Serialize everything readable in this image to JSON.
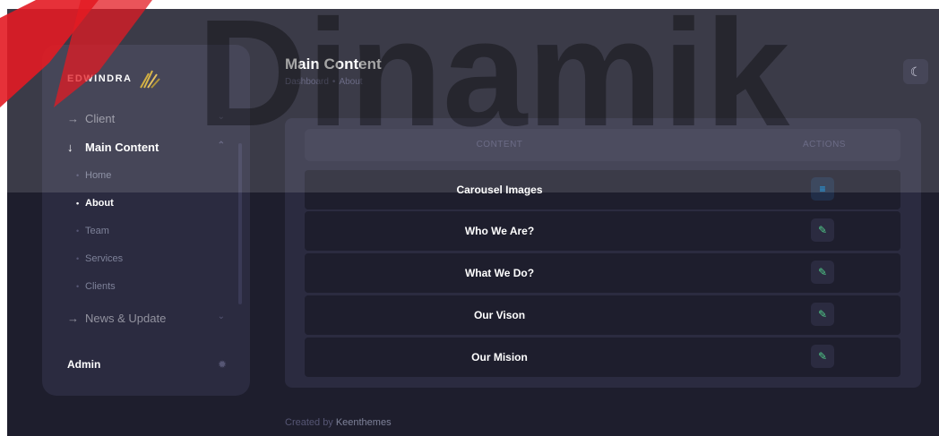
{
  "brand": {
    "name": "EDWINDRA"
  },
  "sidebar": {
    "items": [
      {
        "label": "Client",
        "arrow": "→",
        "chevron": "⌄"
      },
      {
        "label": "Main Content",
        "arrow": "↓",
        "chevron": "⌃"
      },
      {
        "label": "News & Update",
        "arrow": "→",
        "chevron": "⌄"
      }
    ],
    "sub_items": [
      {
        "label": "Home"
      },
      {
        "label": "About"
      },
      {
        "label": "Team"
      },
      {
        "label": "Services"
      },
      {
        "label": "Clients"
      }
    ],
    "admin": {
      "label": "Admin"
    }
  },
  "header": {
    "title": "Main Content",
    "breadcrumb": [
      "Dashboard",
      "About"
    ],
    "breadcrumb_sep": "•"
  },
  "table": {
    "columns": [
      "CONTENT",
      "ACTIONS"
    ],
    "rows": [
      {
        "name": "Carousel Images",
        "action_icon": "list-icon"
      },
      {
        "name": "Who We Are?",
        "action_icon": "pencil-icon"
      },
      {
        "name": "What We Do?",
        "action_icon": "pencil-icon"
      },
      {
        "name": "Our Vison",
        "action_icon": "pencil-icon"
      },
      {
        "name": "Our Mision",
        "action_icon": "pencil-icon"
      }
    ]
  },
  "footer": {
    "created_by": "Created by",
    "brand": "Keenthemes"
  },
  "watermark": {
    "text": "Dinamik"
  },
  "colors": {
    "background": "#1e1e2d",
    "panel": "#2b2b40",
    "accent_blue": "#009ef7",
    "accent_green": "#50cd89",
    "watermark_red": "#e31b23"
  }
}
